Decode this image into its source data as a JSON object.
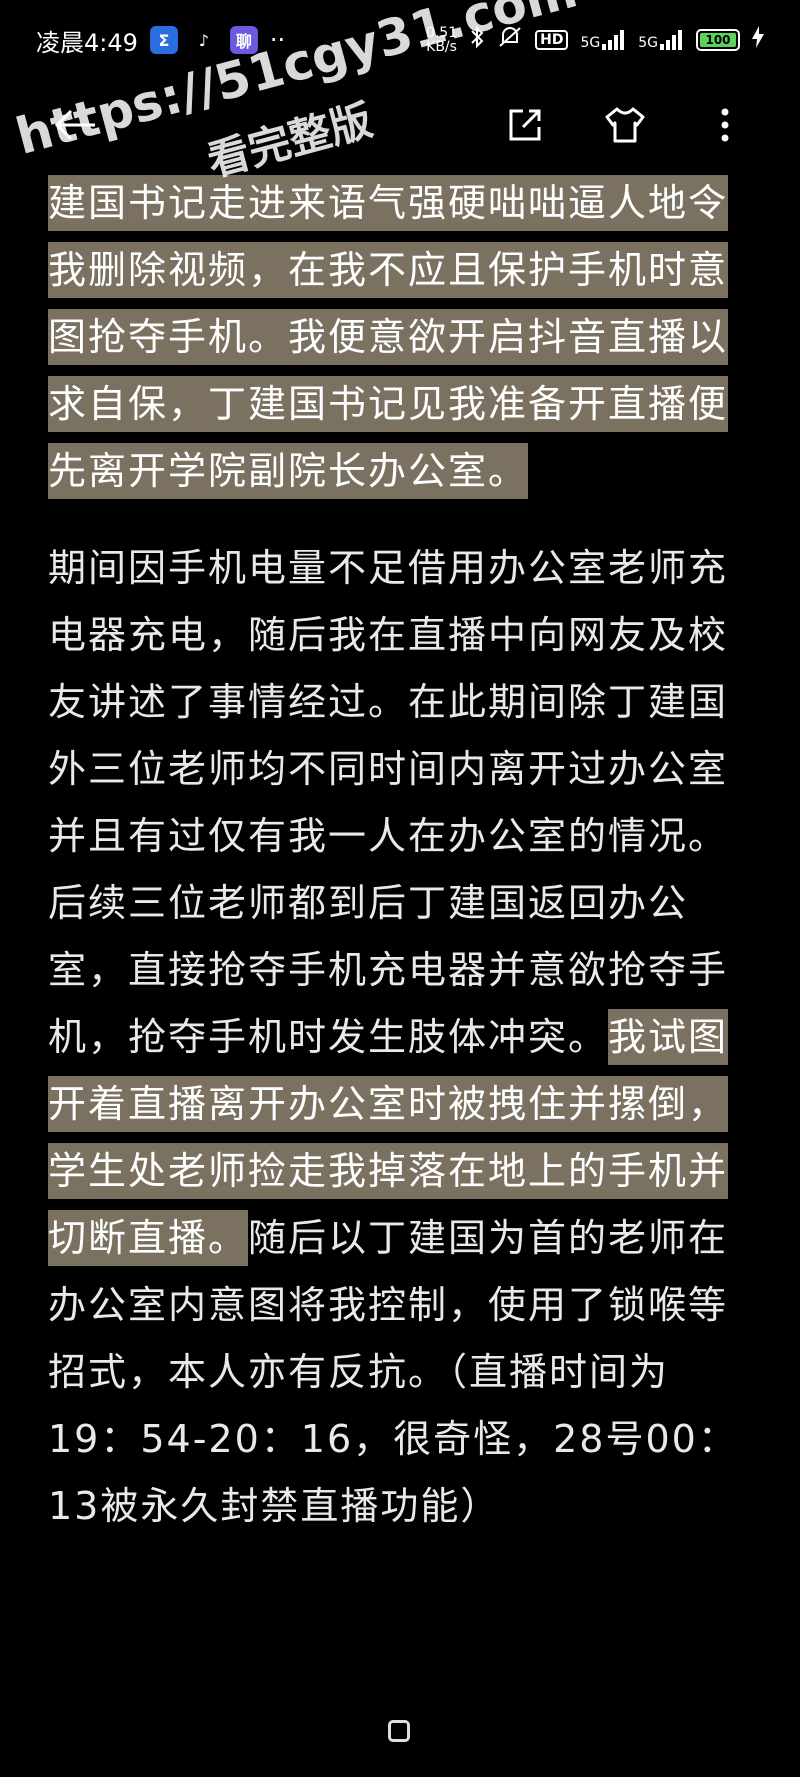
{
  "status_bar": {
    "time": "凌晨4:49",
    "apps": [
      "Σ",
      "♪",
      "聊",
      "··"
    ],
    "network_speed_top": "0.51",
    "network_speed_bottom": "KB/s",
    "hd_badge": "HD",
    "signal_1": "5G",
    "signal_2": "5G",
    "battery": "100",
    "battery_level_pct": 100,
    "battery_color": "#5bd35b"
  },
  "toolbar": {
    "back_icon": "arrow-left-icon",
    "share_icon": "share-icon",
    "theme_icon": "tshirt-icon",
    "more_icon": "more-vertical-icon"
  },
  "watermark": {
    "line1": "https://51cgy31.com",
    "line2": "看完整版"
  },
  "content": {
    "para1": {
      "highlighted": "建国书记走进来语气强硬咄咄逼人地令我删除视频，在我不应且保护手机时意图抢夺手机。我便意欲开启抖音直播以求自保，丁建国书记见我准备开直播便先离开学院副院长办公室。"
    },
    "para2": {
      "before": "期间因手机电量不足借用办公室老师充电器充电，随后我在直播中向网友及校友讲述了事情经过。在此期间除丁建国外三位老师均不同时间内离开过办公室并且有过仅有我一人在办公室的情况。后续三位老师都到后丁建国返回办公室，直接抢夺手机充电器并意欲抢夺手机，抢夺手机时发生肢体冲突。",
      "highlighted": "我试图开着直播离开办公室时被拽住并摞倒，学生处老师捡走我掉落在地上的手机并切断直播。",
      "after": "随后以丁建国为首的老师在办公室内意图将我控制，使用了锁喉等招式，本人亦有反抗。（直播时间为19：54-20：16，很奇怪，28号00：13被永久封禁直播功能）"
    },
    "highlight_color": "#7a7161"
  }
}
